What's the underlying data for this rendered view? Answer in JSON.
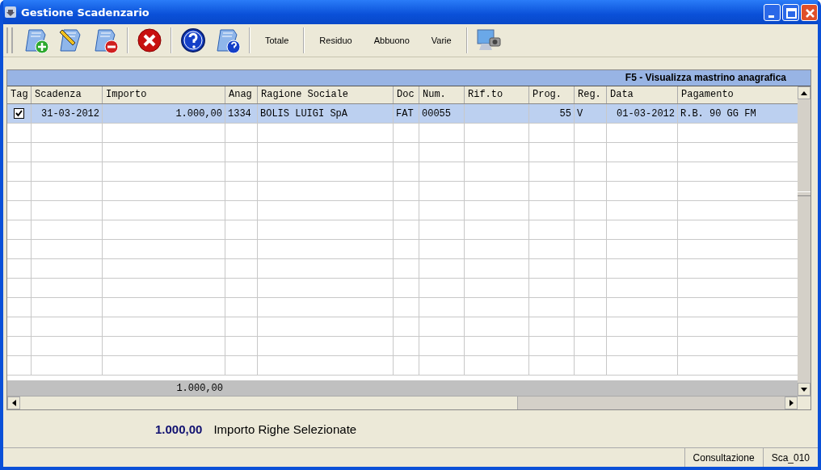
{
  "window": {
    "title": "Gestione Scadenzario"
  },
  "toolbar": {
    "text_buttons": [
      "Totale",
      "Residuo",
      "Abbuono",
      "Varie"
    ]
  },
  "grid": {
    "caption": "F5 - Visualizza mastrino anagrafica",
    "columns": [
      "Tag",
      "Scadenza",
      "Importo",
      "Anag",
      "Ragione Sociale",
      "Doc",
      "Num.",
      "Rif.to",
      "Prog.",
      "Reg.",
      "Data",
      "Pagamento"
    ],
    "rows": [
      {
        "selected": true,
        "checked": true,
        "cells": [
          "",
          "31-03-2012",
          "1.000,00",
          "1334",
          "BOLIS LUIGI SpA",
          "FAT",
          "00055",
          "",
          "55",
          "V",
          "01-03-2012",
          "R.B. 90 GG FM"
        ]
      }
    ],
    "footer_total": "1.000,00"
  },
  "summary": {
    "amount": "1.000,00",
    "label": "Importo Righe Selezionate"
  },
  "status_bar": [
    "Consultazione",
    "Sca_010"
  ]
}
